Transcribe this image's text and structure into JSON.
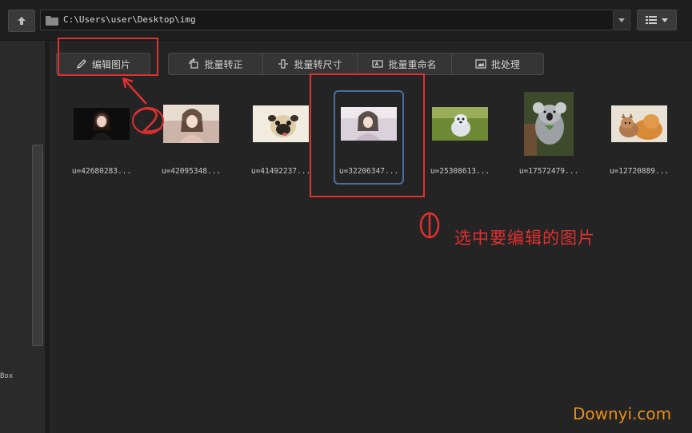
{
  "window": {
    "path": "C:\\Users\\user\\Desktop\\img",
    "left_panel_label": "Box"
  },
  "toolbar": {
    "edit_label": "编辑图片",
    "batch_rotate_label": "批量转正",
    "batch_resize_label": "批量转尺寸",
    "batch_rename_label": "批量重命名",
    "batch_process_label": "批处理"
  },
  "files": [
    {
      "name": "u=42680283...",
      "icon": "woman-portrait-dark",
      "selected": false
    },
    {
      "name": "u=42095348...",
      "icon": "woman-portrait-light",
      "selected": false
    },
    {
      "name": "u=41492237...",
      "icon": "pug-dog",
      "selected": false
    },
    {
      "name": "u=32206347...",
      "icon": "woman-portrait-pale",
      "selected": true
    },
    {
      "name": "u=25308613...",
      "icon": "puppy-on-grass",
      "selected": false
    },
    {
      "name": "u=17572479...",
      "icon": "koala",
      "selected": false
    },
    {
      "name": "u=12720889...",
      "icon": "cat-and-dog",
      "selected": false
    }
  ],
  "annotations": {
    "step1_number": "①",
    "step1_text": "选中要编辑的图片",
    "step2_number": "②",
    "color": "#e03030"
  },
  "watermark": "Downyi.com"
}
